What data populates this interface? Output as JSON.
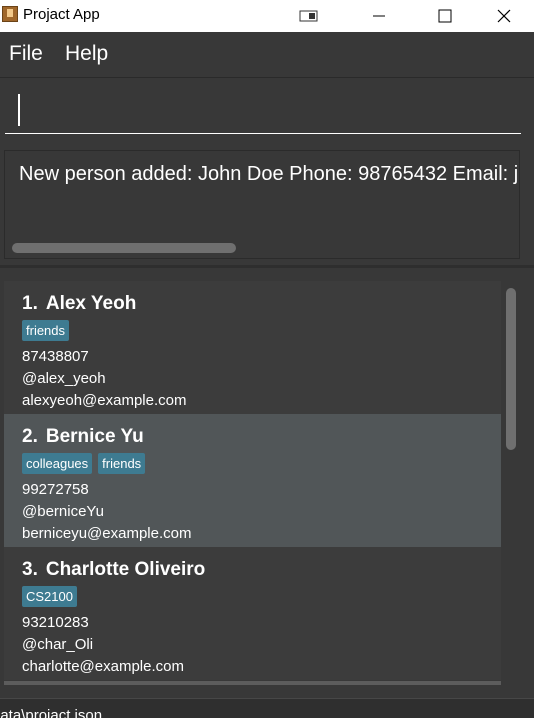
{
  "window": {
    "title": "Projact App",
    "icons": {
      "app": "app-icon",
      "snap": "snap-layout-icon",
      "minimize": "minimize-icon",
      "maximize": "maximize-icon",
      "close": "close-icon"
    }
  },
  "menu": {
    "file": "File",
    "help": "Help"
  },
  "command": {
    "value": ""
  },
  "result": {
    "text": "New person added: John Doe Phone: 98765432 Email: j"
  },
  "persons": [
    {
      "index": "1.",
      "name": "Alex Yeoh",
      "tags": [
        "friends"
      ],
      "phone": "87438807",
      "handle": "@alex_yeoh",
      "email": "alexyeoh@example.com"
    },
    {
      "index": "2.",
      "name": "Bernice Yu",
      "tags": [
        "colleagues",
        "friends"
      ],
      "phone": "99272758",
      "handle": "@berniceYu",
      "email": "berniceyu@example.com"
    },
    {
      "index": "3.",
      "name": "Charlotte Oliveiro",
      "tags": [
        "CS2100"
      ],
      "phone": "93210283",
      "handle": "@char_Oli",
      "email": "charlotte@example.com"
    }
  ],
  "status": {
    "file_path": "data\\projact.json"
  },
  "colors": {
    "background": "#383838",
    "tag": "#3e7b91",
    "selected_row": "#515658"
  }
}
